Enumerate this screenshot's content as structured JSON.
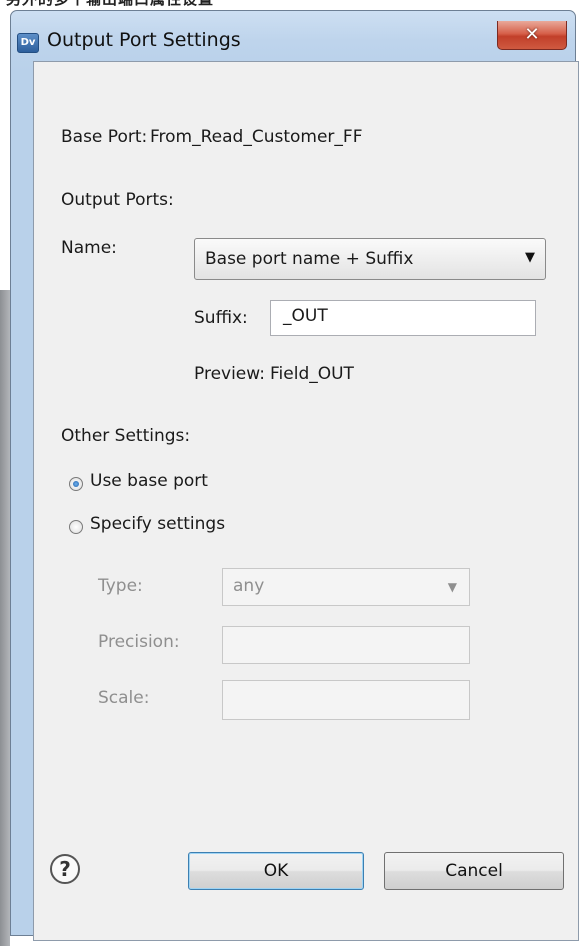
{
  "background_text": "另外的多个输出端口属性设置",
  "window": {
    "title": "Output Port Settings",
    "icon_text": "Dv",
    "close_glyph": "✕"
  },
  "base_port": {
    "label": "Base Port:",
    "value": "From_Read_Customer_FF"
  },
  "output_ports": {
    "heading": "Output Ports:",
    "name_label": "Name:",
    "name_selected": "Base port name + Suffix",
    "suffix_label": "Suffix:",
    "suffix_value": "_OUT",
    "preview_label": "Preview:",
    "preview_value": "Field_OUT"
  },
  "other_settings": {
    "heading": "Other Settings:",
    "use_base_port_label": "Use base port",
    "use_base_port_checked": true,
    "specify_settings_label": "Specify settings",
    "specify_settings_checked": false,
    "type_label": "Type:",
    "type_value": "any",
    "precision_label": "Precision:",
    "precision_value": "",
    "scale_label": "Scale:",
    "scale_value": ""
  },
  "footer": {
    "help_glyph": "?",
    "ok_label": "OK",
    "cancel_label": "Cancel"
  },
  "colors": {
    "close_button": "#c9452f",
    "frame": "#b9d1ea",
    "client": "#f0f0f0",
    "disabled_text": "#8f8f8f"
  },
  "icons": [
    "app-dv-icon",
    "close-icon",
    "dropdown-arrow-icon",
    "help-icon"
  ]
}
